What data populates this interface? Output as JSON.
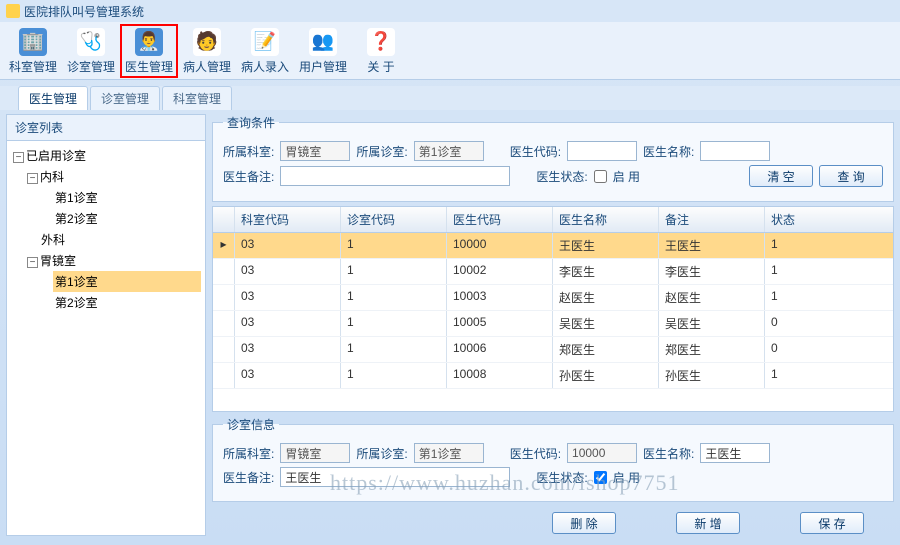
{
  "app": {
    "title": "医院排队叫号管理系统"
  },
  "toolbar": [
    {
      "label": "科室管理",
      "icon": "🏢",
      "bg": "#4a8fd6"
    },
    {
      "label": "诊室管理",
      "icon": "🩺",
      "bg": "#ffffff"
    },
    {
      "label": "医生管理",
      "icon": "👨‍⚕️",
      "bg": "#4a8fd6"
    },
    {
      "label": "病人管理",
      "icon": "🧑",
      "bg": "#ffffff"
    },
    {
      "label": "病人录入",
      "icon": "📝",
      "bg": "#ffffff"
    },
    {
      "label": "用户管理",
      "icon": "👥",
      "bg": "#ffffff"
    },
    {
      "label": "关 于",
      "icon": "❓",
      "bg": "#ffffff"
    }
  ],
  "tabs": [
    {
      "label": "医生管理",
      "active": true
    },
    {
      "label": "诊室管理",
      "active": false
    },
    {
      "label": "科室管理",
      "active": false
    }
  ],
  "left_panel": {
    "title": "诊室列表"
  },
  "tree": {
    "root": "已启用诊室",
    "n1": "内科",
    "n1a": "第1诊室",
    "n1b": "第2诊室",
    "n2": "外科",
    "n3": "胃镜室",
    "n3a": "第1诊室",
    "n3b": "第2诊室"
  },
  "query": {
    "legend": "查询条件",
    "dept_label": "所属科室:",
    "dept": "胃镜室",
    "room_label": "所属诊室:",
    "room": "第1诊室",
    "code_label": "医生代码:",
    "code": "",
    "name_label": "医生名称:",
    "name": "",
    "remark_label": "医生备注:",
    "remark": "",
    "status_label": "医生状态:",
    "status_cb": "启 用",
    "btn_clear": "清 空",
    "btn_search": "查 询"
  },
  "grid": {
    "headers": [
      "",
      "科室代码",
      "诊室代码",
      "医生代码",
      "医生名称",
      "备注",
      "状态"
    ],
    "rows": [
      [
        "▸",
        "03",
        "1",
        "10000",
        "王医生",
        "王医生",
        "1"
      ],
      [
        "",
        "03",
        "1",
        "10002",
        "李医生",
        "李医生",
        "1"
      ],
      [
        "",
        "03",
        "1",
        "10003",
        "赵医生",
        "赵医生",
        "1"
      ],
      [
        "",
        "03",
        "1",
        "10005",
        "吴医生",
        "吴医生",
        "0"
      ],
      [
        "",
        "03",
        "1",
        "10006",
        "郑医生",
        "郑医生",
        "0"
      ],
      [
        "",
        "03",
        "1",
        "10008",
        "孙医生",
        "孙医生",
        "1"
      ]
    ]
  },
  "info": {
    "legend": "诊室信息",
    "dept_label": "所属科室:",
    "dept": "胃镜室",
    "room_label": "所属诊室:",
    "room": "第1诊室",
    "code_label": "医生代码:",
    "code": "10000",
    "name_label": "医生名称:",
    "name": "王医生",
    "remark_label": "医生备注:",
    "remark": "王医生",
    "status_label": "医生状态:",
    "status_cb": "启 用"
  },
  "buttons": {
    "del": "删 除",
    "add": "新 增",
    "save": "保 存"
  },
  "watermark": "https://www.huzhan.com/ishop7751"
}
